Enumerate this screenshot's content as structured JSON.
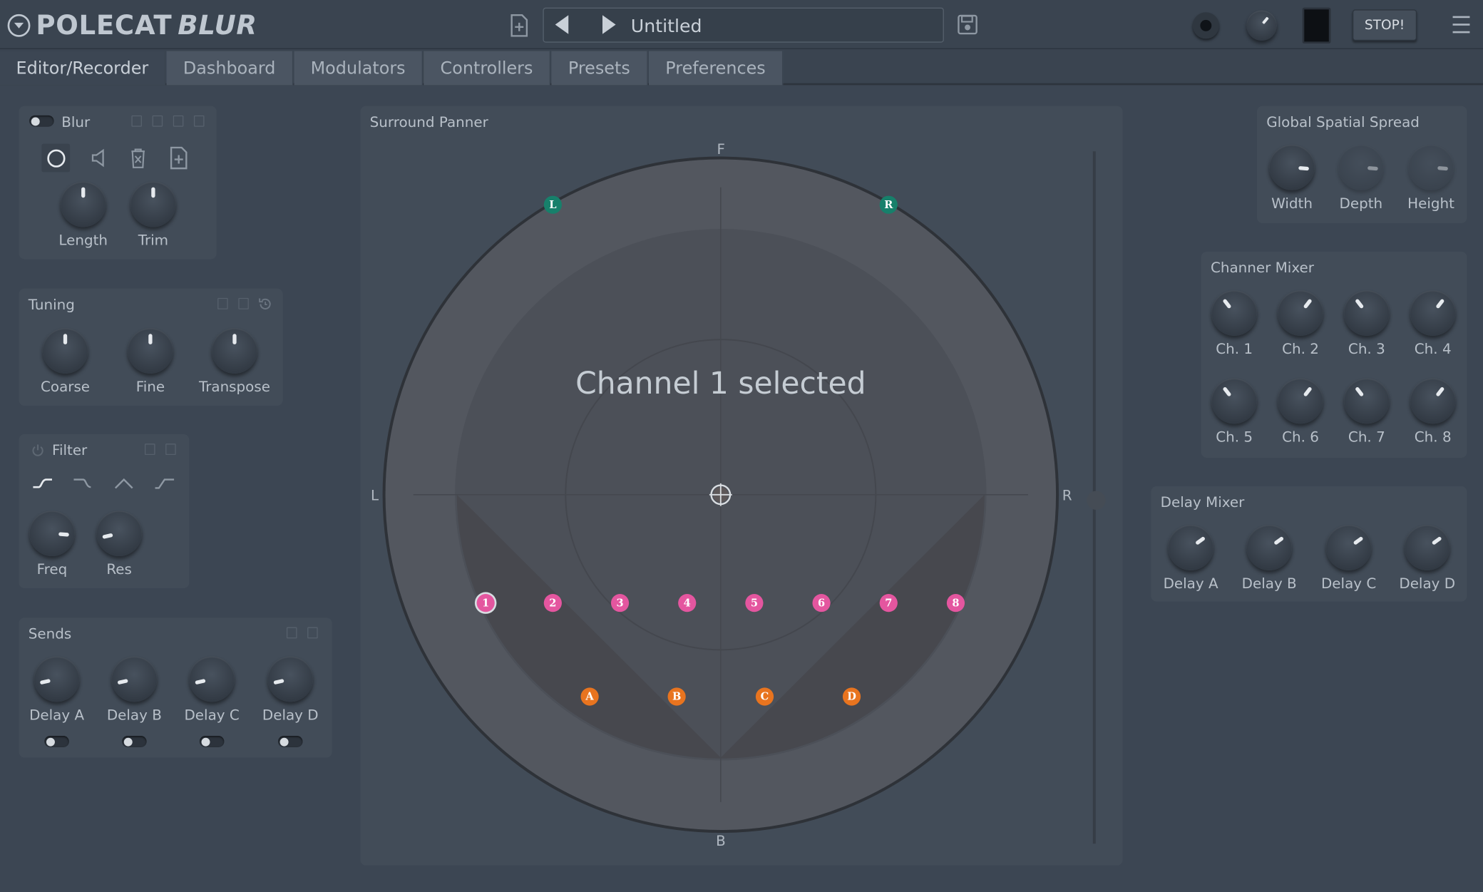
{
  "header": {
    "brand": "POLECAT",
    "product": "BLUR",
    "preset_name": "Untitled",
    "stop_label": "STOP!",
    "icons": [
      "logo-icon",
      "new-preset-icon",
      "prev-preset-icon",
      "next-preset-icon",
      "save-icon",
      "record-icon",
      "output-knob-icon",
      "meter-icon",
      "menu-icon"
    ]
  },
  "tabs": [
    {
      "label": "Editor/Recorder",
      "active": true
    },
    {
      "label": "Dashboard"
    },
    {
      "label": "Modulators"
    },
    {
      "label": "Controllers"
    },
    {
      "label": "Presets"
    },
    {
      "label": "Preferences"
    }
  ],
  "blur_panel": {
    "title": "Blur",
    "knobs": [
      {
        "label": "Length",
        "value": 0.5
      },
      {
        "label": "Trim",
        "value": 0.5
      }
    ]
  },
  "tuning_panel": {
    "title": "Tuning",
    "knobs": [
      {
        "label": "Coarse",
        "value": 0.5
      },
      {
        "label": "Fine",
        "value": 0.5
      },
      {
        "label": "Transpose",
        "value": 0.5
      }
    ]
  },
  "filter_panel": {
    "title": "Filter",
    "types": [
      "highpass-icon",
      "lowpass-icon",
      "bandpass-icon",
      "highshelf-icon"
    ],
    "knobs": [
      {
        "label": "Freq",
        "value": 0.85
      },
      {
        "label": "Res",
        "value": 0.12
      }
    ]
  },
  "sends_panel": {
    "title": "Sends",
    "knobs": [
      {
        "label": "Delay A",
        "value": 0.12
      },
      {
        "label": "Delay B",
        "value": 0.12
      },
      {
        "label": "Delay C",
        "value": 0.12
      },
      {
        "label": "Delay D",
        "value": 0.12
      }
    ]
  },
  "panner": {
    "title": "Surround Panner",
    "status": "Channel 1 selected",
    "labels": {
      "front": "F",
      "back": "B",
      "left": "L",
      "right": "R"
    },
    "speakers": [
      "L",
      "R"
    ],
    "channels": [
      "1",
      "2",
      "3",
      "4",
      "5",
      "6",
      "7",
      "8"
    ],
    "selected_channel": "1",
    "delays": [
      "A",
      "B",
      "C",
      "D"
    ],
    "colors": {
      "channel": "#e4569f",
      "delay": "#e8741f",
      "speaker": "#17806b"
    }
  },
  "spread_panel": {
    "title": "Global Spatial Spread",
    "knobs": [
      {
        "label": "Width",
        "value": 0.85
      },
      {
        "label": "Depth",
        "value": 0.85
      },
      {
        "label": "Height",
        "value": 0.85
      }
    ]
  },
  "channel_mixer": {
    "title": "Channer Mixer",
    "knobs": [
      {
        "label": "Ch. 1",
        "value": 0.36
      },
      {
        "label": "Ch. 2",
        "value": 0.64
      },
      {
        "label": "Ch. 3",
        "value": 0.36
      },
      {
        "label": "Ch. 4",
        "value": 0.64
      },
      {
        "label": "Ch. 5",
        "value": 0.36
      },
      {
        "label": "Ch. 6",
        "value": 0.64
      },
      {
        "label": "Ch. 7",
        "value": 0.36
      },
      {
        "label": "Ch. 8",
        "value": 0.64
      }
    ]
  },
  "delay_mixer": {
    "title": "Delay Mixer",
    "knobs": [
      {
        "label": "Delay A",
        "value": 0.7
      },
      {
        "label": "Delay B",
        "value": 0.7
      },
      {
        "label": "Delay C",
        "value": 0.7
      },
      {
        "label": "Delay D",
        "value": 0.7
      }
    ]
  }
}
